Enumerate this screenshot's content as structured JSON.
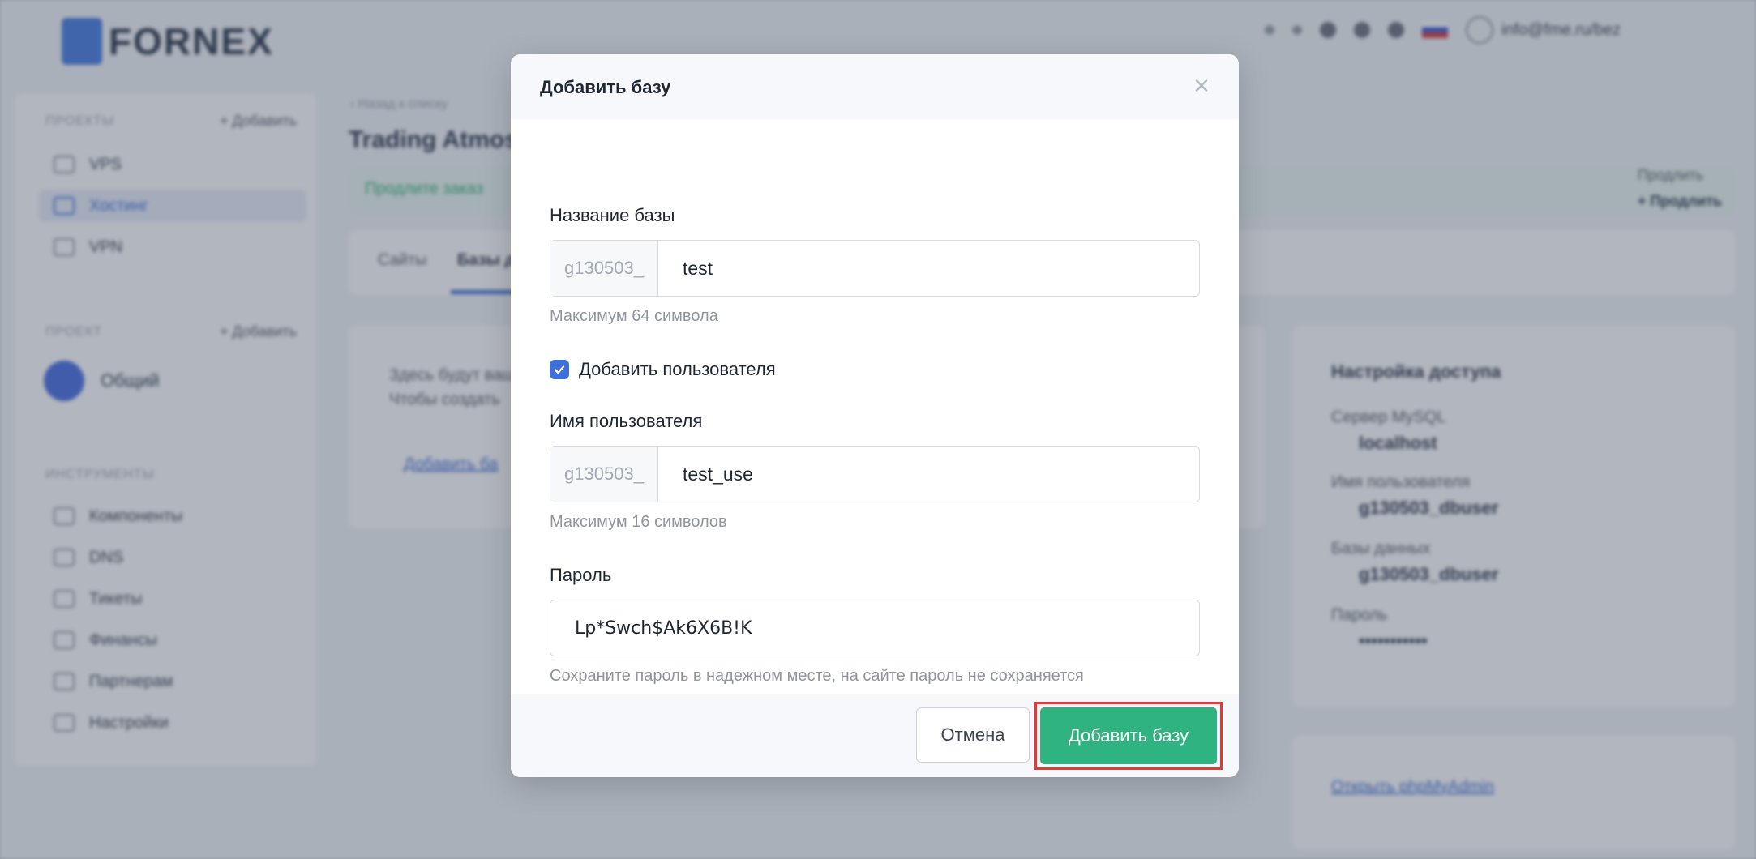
{
  "background": {
    "logo_text": "FORNEX",
    "user_email": "info@fme.ru/bez",
    "sidebar": {
      "section1_label": "ПРОЕКТЫ",
      "section1_action": "+ Добавить",
      "items": [
        {
          "label": "VPS"
        },
        {
          "label": "Хостинг"
        },
        {
          "label": "VPN"
        }
      ],
      "section2_label": "ПРОЕКТ",
      "section2_action": "+ Добавить",
      "project_name": "Общий",
      "section3_label": "ИНСТРУМЕНТЫ",
      "tools": [
        {
          "label": "Компоненты"
        },
        {
          "label": "DNS"
        },
        {
          "label": "Тикеты"
        },
        {
          "label": "Финансы"
        },
        {
          "label": "Партнерам"
        },
        {
          "label": "Настройки"
        }
      ]
    },
    "breadcrumb": "‹ Назад к списку",
    "page_title": "Trading Atmosp",
    "notice": "Продлите заказ",
    "tabs": [
      "Сайты",
      "Базы д"
    ],
    "right_meta": [
      "Продлить",
      "+ Продлить"
    ],
    "empty_text_line1": "Здесь будут ваши",
    "empty_text_line2": "Чтобы создать",
    "empty_add_link": "Добавить ба",
    "access_panel": {
      "title": "Настройка доступа",
      "rows": [
        {
          "label": "Сервер MySQL",
          "value": "localhost"
        },
        {
          "label": "Имя пользователя",
          "value": "g130503_dbuser"
        },
        {
          "label": "Базы данных",
          "value": "g130503_dbuser"
        },
        {
          "label": "Пароль",
          "value": "•••••••••••"
        }
      ],
      "link": "Открыть phpMyAdmin"
    }
  },
  "modal": {
    "title": "Добавить базу",
    "close_symbol": "×",
    "db_name": {
      "label": "Название базы",
      "prefix": "g130503_",
      "value": "test",
      "hint": "Максимум 64 символа"
    },
    "add_user": {
      "label": "Добавить пользователя",
      "checked": true
    },
    "username": {
      "label": "Имя пользователя",
      "prefix": "g130503_",
      "value": "test_use",
      "hint": "Максимум 16 символов"
    },
    "password": {
      "label": "Пароль",
      "value": "Lp*Swch$Ak6X6B!K",
      "hint": "Сохраните пароль в надежном месте, на сайте пароль не сохраняется"
    },
    "cancel_label": "Отмена",
    "submit_label": "Добавить базу"
  }
}
